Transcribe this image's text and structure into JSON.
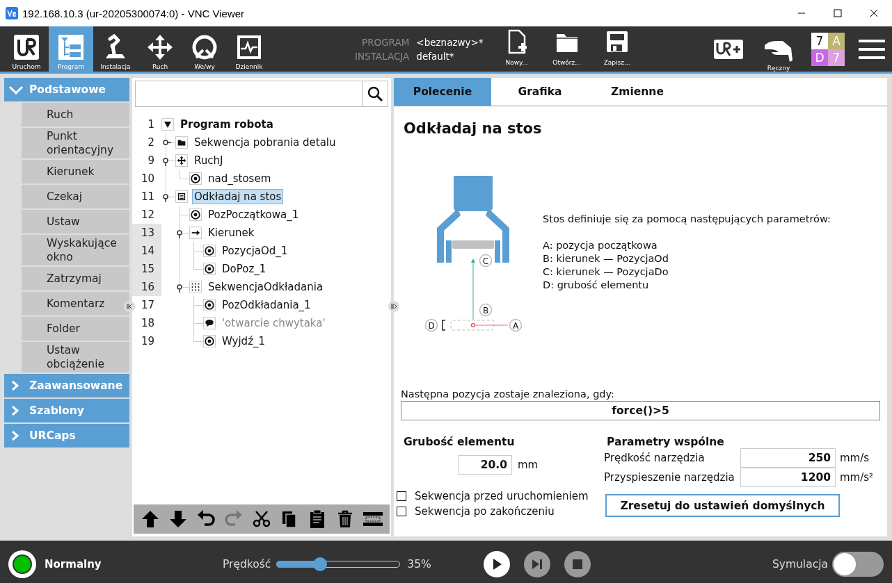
{
  "window": {
    "title": "192.168.10.3 (ur-20205300074:0) - VNC Viewer"
  },
  "nav": [
    {
      "label": "Uruchom",
      "kind": "logo",
      "selected": false
    },
    {
      "label": "Program",
      "kind": "program",
      "selected": true
    },
    {
      "label": "Instalacja",
      "kind": "arm",
      "selected": false
    },
    {
      "label": "Ruch",
      "kind": "move",
      "selected": false
    },
    {
      "label": "We/wy",
      "kind": "io",
      "selected": false
    },
    {
      "label": "Dziennik",
      "kind": "log",
      "selected": false
    }
  ],
  "file_info": {
    "program_label": "PROGRAM",
    "program": "<beznazwy>*",
    "installation_label": "INSTALACJA",
    "installation": "default*"
  },
  "file_buttons": [
    {
      "label": "Nowy...",
      "kind": "new"
    },
    {
      "label": "Otwórz...",
      "kind": "open"
    },
    {
      "label": "Zapisz...",
      "kind": "save"
    }
  ],
  "mode": {
    "label": "Ręczny"
  },
  "speed_grid": [
    {
      "text": "7",
      "color": "#ffffff"
    },
    {
      "text": "A",
      "color": "#bdb571"
    },
    {
      "text": "D",
      "color": "#c966e6"
    },
    {
      "text": "7",
      "color": "#dba2de"
    }
  ],
  "sidebar": [
    {
      "label": "Podstawowe",
      "expanded": true,
      "items": [
        "Ruch",
        "Punkt orientacyjny",
        "Kierunek",
        "Czekaj",
        "Ustaw",
        "Wyskakujące okno",
        "Zatrzymaj",
        "Komentarz",
        "Folder",
        "Ustaw obciążenie"
      ]
    },
    {
      "label": "Zaawansowane",
      "expanded": false
    },
    {
      "label": "Szablony",
      "expanded": false
    },
    {
      "label": "URCaps",
      "expanded": false
    }
  ],
  "tree": {
    "nodes": [
      {
        "line": "1",
        "label": "Program robota",
        "kind": "root",
        "expanded": true,
        "selected": false,
        "highlighted": false,
        "children": [
          {
            "line": "2",
            "label": "Sekwencja pobrania detalu",
            "kind": "folder",
            "expanded": false,
            "selected": false,
            "highlighted": false
          },
          {
            "line": "9",
            "label": "RuchJ",
            "kind": "move",
            "expanded": true,
            "selected": false,
            "highlighted": false,
            "children": [
              {
                "line": "10",
                "label": "nad_stosem",
                "kind": "waypoint",
                "selected": false,
                "highlighted": false
              }
            ]
          },
          {
            "line": "11",
            "label": "Odkładaj na stos",
            "kind": "stack",
            "expanded": true,
            "selected": true,
            "highlighted": false,
            "children": [
              {
                "line": "12",
                "label": "PozPoczątkowa_1",
                "kind": "waypoint",
                "selected": false,
                "highlighted": false
              },
              {
                "line": "13",
                "label": "Kierunek",
                "kind": "direction",
                "expanded": true,
                "selected": false,
                "highlighted": true,
                "children": [
                  {
                    "line": "14",
                    "label": "PozycjaOd_1",
                    "kind": "waypoint",
                    "selected": false,
                    "highlighted": true
                  },
                  {
                    "line": "15",
                    "label": "DoPoz_1",
                    "kind": "waypoint",
                    "selected": false,
                    "highlighted": true
                  }
                ]
              },
              {
                "line": "16",
                "label": "SekwencjaOdkładania",
                "kind": "sequence",
                "expanded": true,
                "selected": false,
                "highlighted": true,
                "children": [
                  {
                    "line": "17",
                    "label": "PozOdkładania_1",
                    "kind": "waypoint",
                    "selected": false,
                    "highlighted": false
                  },
                  {
                    "line": "18",
                    "label": "'otwarcie chwytaka'",
                    "kind": "comment",
                    "selected": false,
                    "highlighted": false
                  },
                  {
                    "line": "19",
                    "label": "Wyjdź_1",
                    "kind": "waypoint",
                    "selected": false,
                    "highlighted": false
                  }
                ]
              }
            ]
          }
        ]
      }
    ],
    "toolbar": [
      {
        "kind": "up",
        "disabled": false
      },
      {
        "kind": "down",
        "disabled": false
      },
      {
        "kind": "undo",
        "disabled": false
      },
      {
        "kind": "redo",
        "disabled": true
      },
      {
        "kind": "cut",
        "disabled": false
      },
      {
        "kind": "copy",
        "disabled": false
      },
      {
        "kind": "paste",
        "disabled": false
      },
      {
        "kind": "delete",
        "disabled": false
      },
      {
        "kind": "suppress",
        "disabled": false
      }
    ]
  },
  "tabs": [
    {
      "label": "Polecenie",
      "selected": true
    },
    {
      "label": "Grafika",
      "selected": false
    },
    {
      "label": "Zmienne",
      "selected": false
    }
  ],
  "command": {
    "title": "Odkładaj na stos",
    "diagram_labels": {
      "c": "C",
      "b": "B",
      "d": "D",
      "a": "A"
    },
    "description": "Stos definiuje się za pomocą następujących parametrów:",
    "parameters": [
      "A: pozycja początkowa",
      "B: kierunek — PozycjaOd",
      "C: kierunek — PozycjaDo",
      "D: grubość elementu"
    ],
    "condition_label": "Następna pozycja zostaje znaleziona, gdy:",
    "condition": "force()>5",
    "thickness": {
      "title": "Grubość elementu",
      "value": "20.0",
      "unit": "mm"
    },
    "checkboxes": [
      {
        "label": "Sekwencja przed uruchomieniem",
        "checked": false
      },
      {
        "label": "Sekwencja po zakończeniu",
        "checked": false
      }
    ],
    "common": {
      "title": "Parametry wspólne",
      "rows": [
        {
          "label": "Prędkość narzędzia",
          "value": "250",
          "unit": "mm/s"
        },
        {
          "label": "Przyspieszenie narzędzia",
          "value": "1200",
          "unit": "mm/s²"
        }
      ],
      "reset": "Zresetuj do ustawień domyślnych"
    }
  },
  "status_bar": {
    "status": {
      "label": "Normalny",
      "color": "#00c000"
    },
    "speed_label": "Prędkość",
    "speed": {
      "level": 0.35,
      "reading": "35%"
    },
    "controls": [
      {
        "kind": "play",
        "disabled": false
      },
      {
        "kind": "step",
        "disabled": true
      },
      {
        "kind": "stop",
        "disabled": true
      }
    ],
    "simulation_label": "Symulacja",
    "simulation": {
      "on": false
    }
  }
}
